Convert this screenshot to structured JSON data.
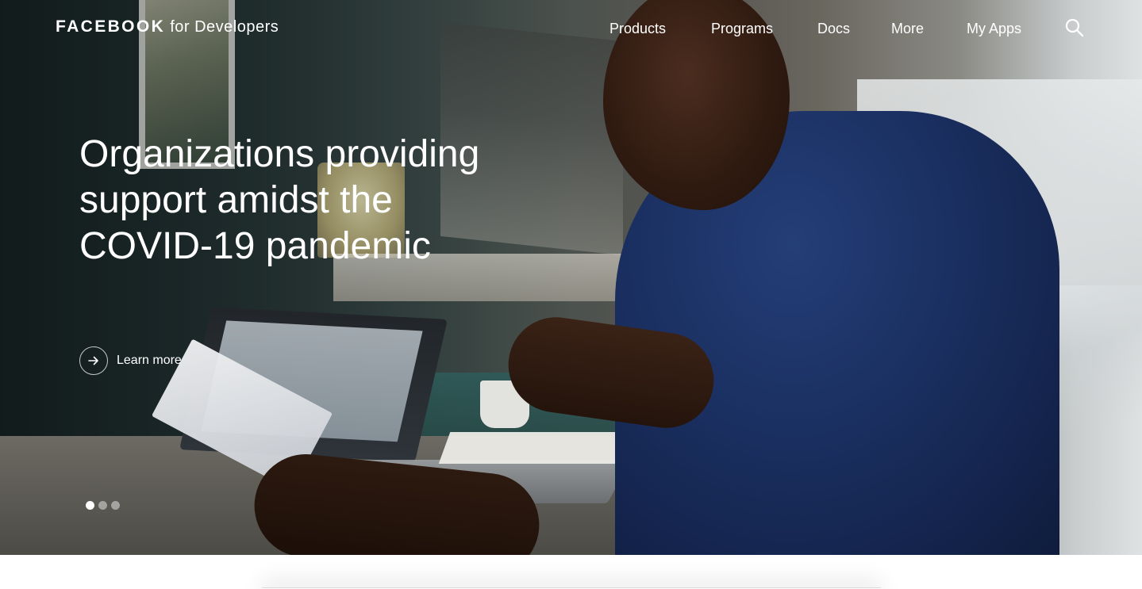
{
  "nav": {
    "brand": {
      "name": "FACEBOOK",
      "suffix": "for Developers"
    },
    "links": [
      {
        "label": "Products"
      },
      {
        "label": "Programs"
      },
      {
        "label": "Docs"
      },
      {
        "label": "More"
      },
      {
        "label": "My Apps"
      }
    ],
    "search_icon": "search-icon"
  },
  "hero": {
    "headline": "Organizations providing support amidst the COVID-19 pandemic",
    "cta": {
      "label": "Learn more",
      "icon": "arrow-right-icon"
    },
    "carousel": {
      "total": 3,
      "active": 1
    }
  },
  "colors": {
    "text_on_hero": "#ffffff",
    "page_background": "#ffffff"
  }
}
